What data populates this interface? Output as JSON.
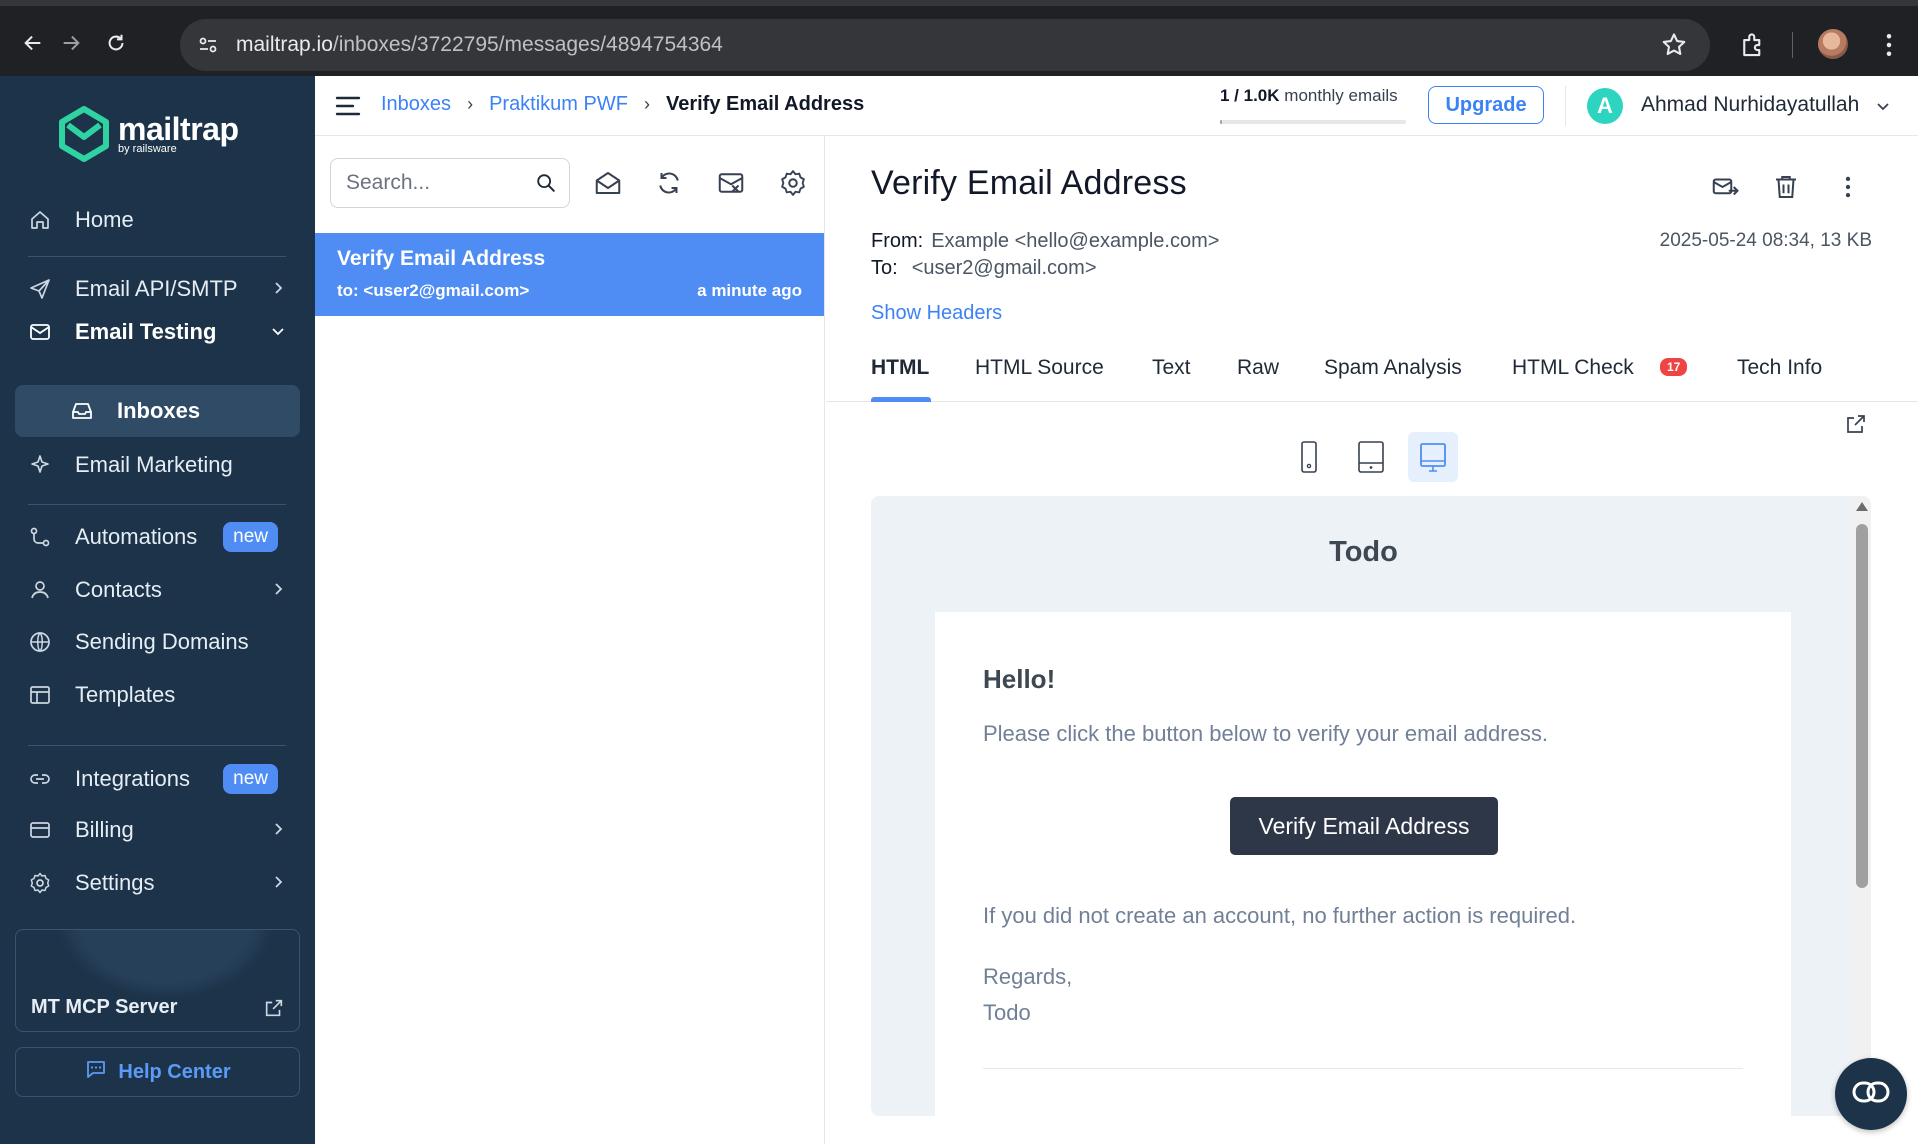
{
  "browser": {
    "url_host": "mailtrap.io",
    "url_path": "/inboxes/3722795/messages/4894754364"
  },
  "logo": {
    "name": "mailtrap",
    "sub": "by railsware"
  },
  "sidebar": {
    "items": [
      {
        "label": "Home",
        "icon": "home-icon"
      },
      {
        "label": "Email API/SMTP",
        "icon": "send-icon"
      },
      {
        "label": "Email Testing",
        "icon": "email-testing-icon"
      },
      {
        "label": "Inboxes",
        "icon": "inbox-icon"
      },
      {
        "label": "Email Marketing",
        "icon": "sparkle-icon"
      },
      {
        "label": "Automations",
        "icon": "automation-icon",
        "badge": "new"
      },
      {
        "label": "Contacts",
        "icon": "contacts-icon"
      },
      {
        "label": "Sending Domains",
        "icon": "globe-icon"
      },
      {
        "label": "Templates",
        "icon": "templates-icon"
      },
      {
        "label": "Integrations",
        "icon": "link-icon",
        "badge": "new"
      },
      {
        "label": "Billing",
        "icon": "card-icon"
      },
      {
        "label": "Settings",
        "icon": "gear-icon"
      }
    ],
    "mcp_label": "MT MCP Server",
    "help_label": "Help Center"
  },
  "header": {
    "breadcrumb": [
      "Inboxes",
      "Praktikum PWF",
      "Verify Email Address"
    ],
    "quota_used": "1 / 1.0K",
    "quota_suffix": "monthly emails",
    "quota_fraction": 0.001,
    "upgrade_label": "Upgrade",
    "user_initial": "A",
    "user_name": "Ahmad Nurhidayatullah"
  },
  "list": {
    "search_placeholder": "Search...",
    "messages": [
      {
        "subject": "Verify Email Address",
        "to": "to: <user2@gmail.com>",
        "time": "a minute ago"
      }
    ]
  },
  "message": {
    "title": "Verify Email Address",
    "from_label": "From:",
    "from_value": "Example <hello@example.com>",
    "to_label": "To:",
    "to_value": "<user2@gmail.com>",
    "date": "2025-05-24 08:34, 13 KB",
    "show_headers": "Show Headers",
    "tabs": [
      "HTML",
      "HTML Source",
      "Text",
      "Raw",
      "Spam Analysis",
      "HTML Check",
      "Tech Info"
    ],
    "html_check_badge": "17"
  },
  "preview": {
    "brand": "Todo",
    "greeting": "Hello!",
    "line1": "Please click the button below to verify your email address.",
    "button": "Verify Email Address",
    "line2": "If you did not create an account, no further action is required.",
    "regards": "Regards,",
    "sign": "Todo"
  },
  "colors": {
    "sidebar_bg": "#1c3349",
    "accent": "#4f8df5",
    "link": "#3b82f6",
    "badge_red": "#ef4444"
  }
}
